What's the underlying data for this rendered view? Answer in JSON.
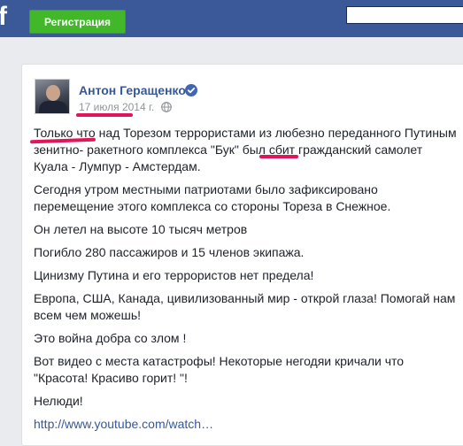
{
  "topbar": {
    "logo_letter": "f",
    "register_label": "Регистрация"
  },
  "post": {
    "author": "Антон Геращенко",
    "date": "17 июля 2014 г.",
    "paragraph1_prefix": "Только что",
    "paragraph1_middle": " над Торезом террористами из любезно переданного Путиным зенитно- ракетного комплекса ",
    "paragraph1_buk": "\"Бук\"",
    "paragraph1_suffix": " был сбит гражданский самолет Куала - Лумпур - Амстердам.",
    "paragraph2": "Сегодня утром местными патриотами было зафиксировано перемещение этого комплекса со стороны Тореза в Снежное.",
    "paragraph3": "Он летел на высоте 10 тысяч метров",
    "paragraph4": "Погибло 280 пассажиров и 15 членов экипажа.",
    "paragraph5": "Цинизму Путина и его террористов нет предела!",
    "paragraph6": "Европа, США, Канада, цивилизованный мир - открой глаза! Помогай нам всем чем можешь!",
    "paragraph7": "Это война добра со злом !",
    "paragraph8": "Вот видео с места катастрофы! Некоторые негодяи кричали что \"Красота! Красиво горит! \"!",
    "paragraph9": "Нелюди!",
    "link": "http://www.youtube.com/watch…"
  },
  "colors": {
    "facebook_blue": "#3b5998",
    "register_green": "#42b72a",
    "highlight_red": "#e2145a",
    "author_blue": "#365899"
  },
  "icons": {
    "verified": "verified-badge-icon",
    "privacy": "globe-icon"
  }
}
